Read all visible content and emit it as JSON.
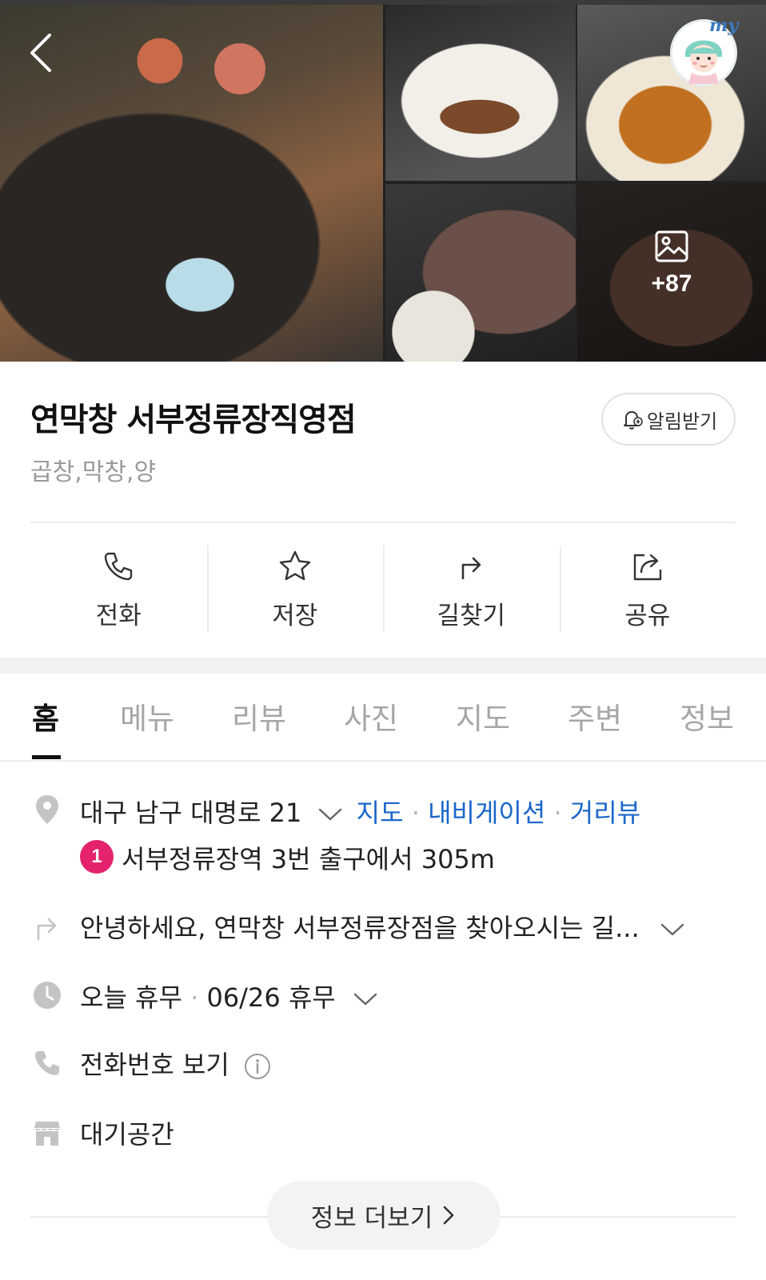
{
  "gallery": {
    "more_count": "+87"
  },
  "header": {
    "avatar_label": "my"
  },
  "place": {
    "name": "연막창 서부정류장직영점",
    "category": "곱창,막창,양",
    "notify_label": "알림받기"
  },
  "actions": [
    {
      "label": "전화",
      "icon": "phone-icon"
    },
    {
      "label": "저장",
      "icon": "star-icon"
    },
    {
      "label": "길찾기",
      "icon": "directions-icon"
    },
    {
      "label": "공유",
      "icon": "share-icon"
    }
  ],
  "tabs": [
    {
      "label": "홈",
      "active": true
    },
    {
      "label": "메뉴"
    },
    {
      "label": "리뷰"
    },
    {
      "label": "사진"
    },
    {
      "label": "지도"
    },
    {
      "label": "주변"
    },
    {
      "label": "정보"
    }
  ],
  "info": {
    "address": "대구 남구 대명로 21",
    "links": {
      "map": "지도",
      "navigation": "내비게이션",
      "street_view": "거리뷰"
    },
    "subway": {
      "line": "1",
      "text": "서부정류장역 3번 출구에서 305m"
    },
    "directions": "안녕하세요, 연막창 서부정류장점을 찾아오시는 길...",
    "hours_today": "오늘 휴무",
    "hours_next": "06/26 휴무",
    "phone": "전화번호 보기",
    "facility": "대기공간",
    "more_info": "정보 더보기"
  },
  "colors": {
    "accent_blue": "#1a66c9",
    "subway_line1": "#e5226e",
    "muted": "#9a9a9a"
  }
}
